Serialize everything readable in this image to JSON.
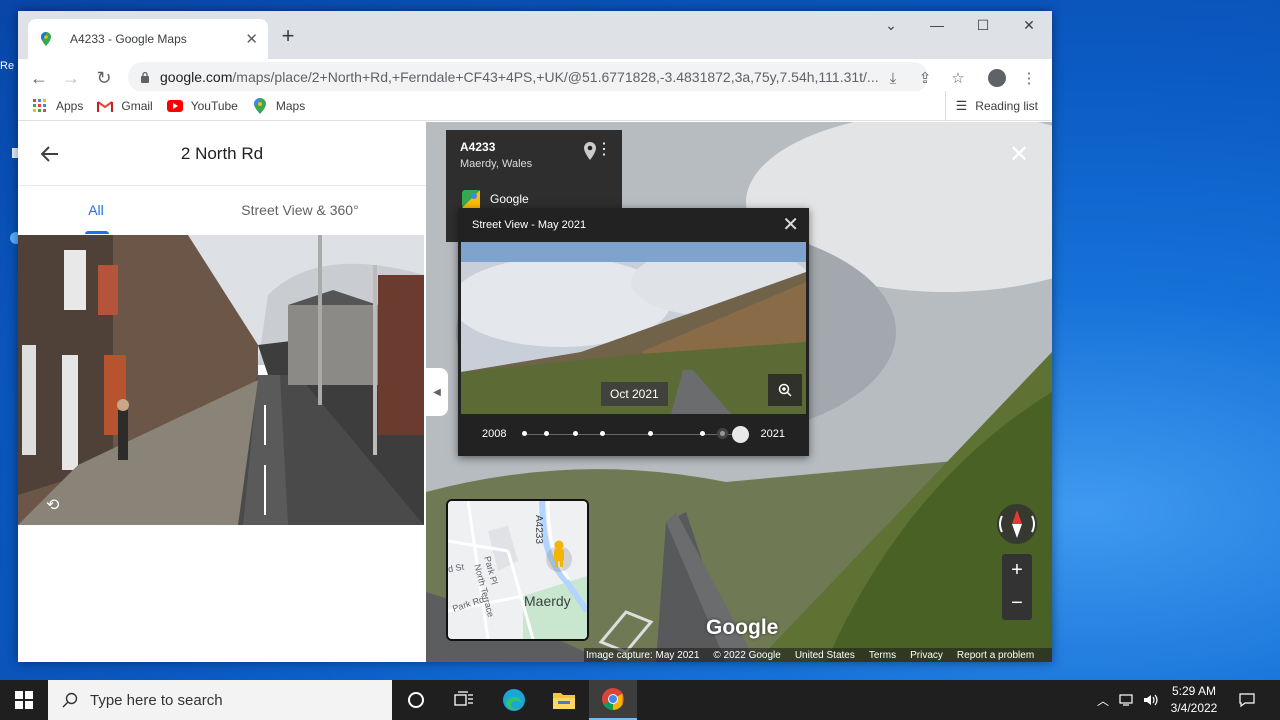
{
  "browser": {
    "tab_title": "A4233 - Google Maps",
    "url_host": "google.com",
    "url_path": "/maps/place/2+North+Rd,+Ferndale+CF43+4PS,+UK/@51.6771828,-3.4831872,3a,75y,7.54h,111.31t/...",
    "bookmarks": [
      {
        "label": "Apps",
        "icon": "apps-grid-icon"
      },
      {
        "label": "Gmail",
        "icon": "gmail-icon"
      },
      {
        "label": "YouTube",
        "icon": "youtube-icon"
      },
      {
        "label": "Maps",
        "icon": "maps-icon"
      }
    ],
    "reading_list": "Reading list"
  },
  "panel": {
    "title": "2 North Rd",
    "tabs": [
      "All",
      "Street View & 360°"
    ],
    "active_tab": "All"
  },
  "streetview": {
    "road": "A4233",
    "area": "Maerdy, Wales",
    "provider": "Google",
    "timemachine_title": "Street View - May 2021",
    "hover_date": "Oct 2021",
    "year_start": "2008",
    "year_end": "2021",
    "minimap": {
      "place": "Maerdy",
      "road_label": "A4233",
      "streets": [
        "d St",
        "Park Pl",
        "North Terrace",
        "Park Rd"
      ]
    },
    "logo": "Google",
    "footer": [
      "Image capture: May 2021",
      "© 2022 Google",
      "United States",
      "Terms",
      "Privacy",
      "Report a problem"
    ]
  },
  "taskbar": {
    "search_placeholder": "Type here to search",
    "time": "5:29 AM",
    "date": "3/4/2022"
  },
  "colors": {
    "accent": "#1a73e8",
    "desktop": "#0b5bc4",
    "taskbar": "#1f1f1f"
  }
}
